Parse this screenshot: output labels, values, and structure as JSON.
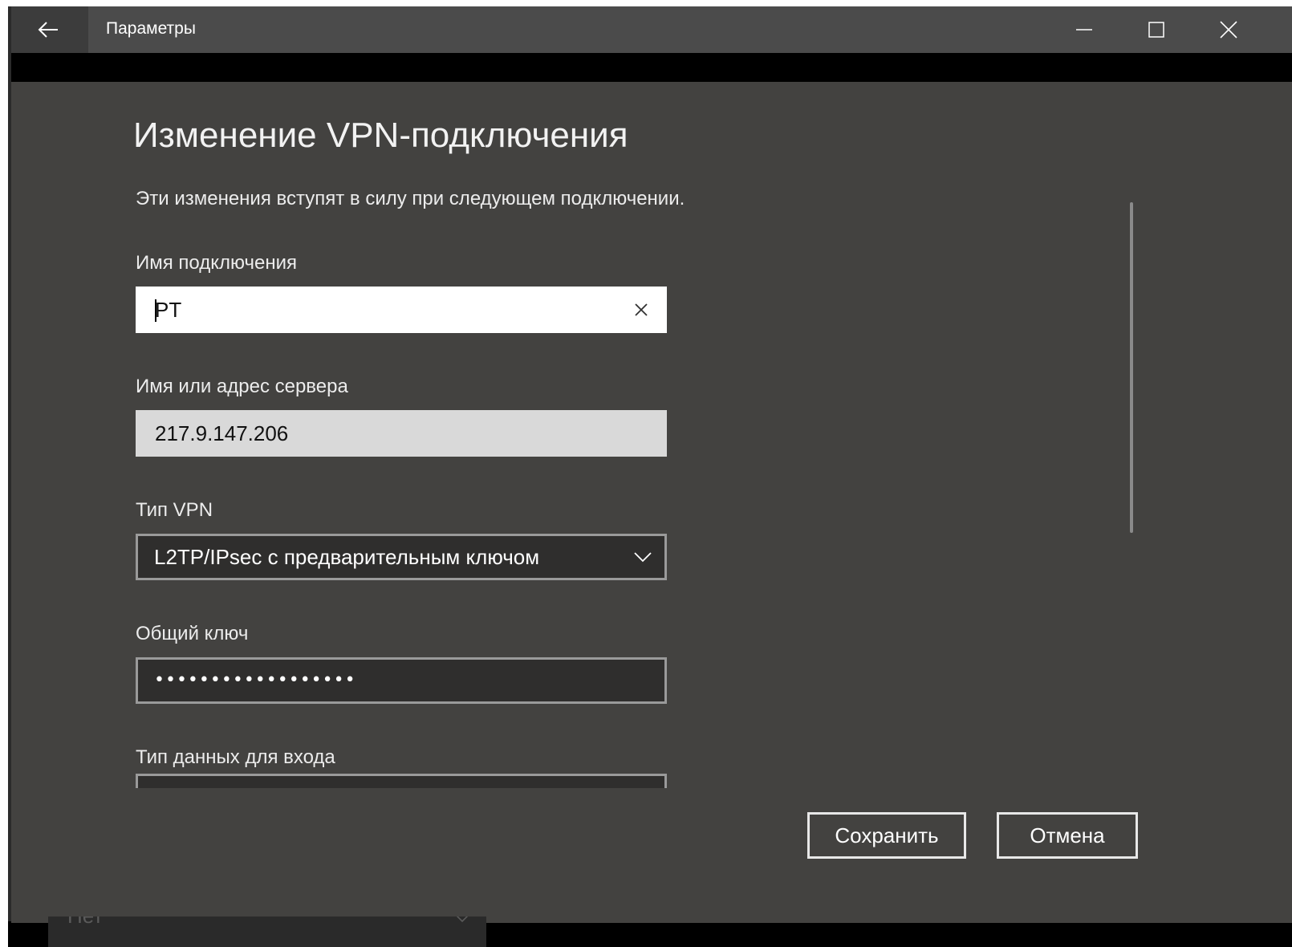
{
  "window": {
    "title": "Параметры",
    "icons": {
      "back": "arrow-left-icon",
      "minimize": "minimize-icon",
      "maximize": "maximize-icon",
      "close": "close-icon"
    }
  },
  "dialog": {
    "heading": "Изменение VPN-подключения",
    "subtitle": "Эти изменения вступят в силу при следующем подключении.",
    "fields": {
      "connection_name": {
        "label": "Имя подключения",
        "value": "PT"
      },
      "server": {
        "label": "Имя или адрес сервера",
        "value": "217.9.147.206"
      },
      "vpn_type": {
        "label": "Тип VPN",
        "value": "L2TP/IPsec с предварительным ключом"
      },
      "shared_key": {
        "label": "Общий ключ",
        "value": "••••••••••••••••••"
      },
      "signin_type": {
        "label": "Тип данных для входа"
      }
    },
    "buttons": {
      "save": "Сохранить",
      "cancel": "Отмена"
    }
  },
  "background": {
    "select_value": "Нет"
  },
  "colors": {
    "titlebar": "#4b4b4b",
    "dialog_bg": "#434240",
    "input_bg": "#ffffff",
    "readonly_bg": "#d9d9d9",
    "select_bg": "#2f2e2d"
  }
}
